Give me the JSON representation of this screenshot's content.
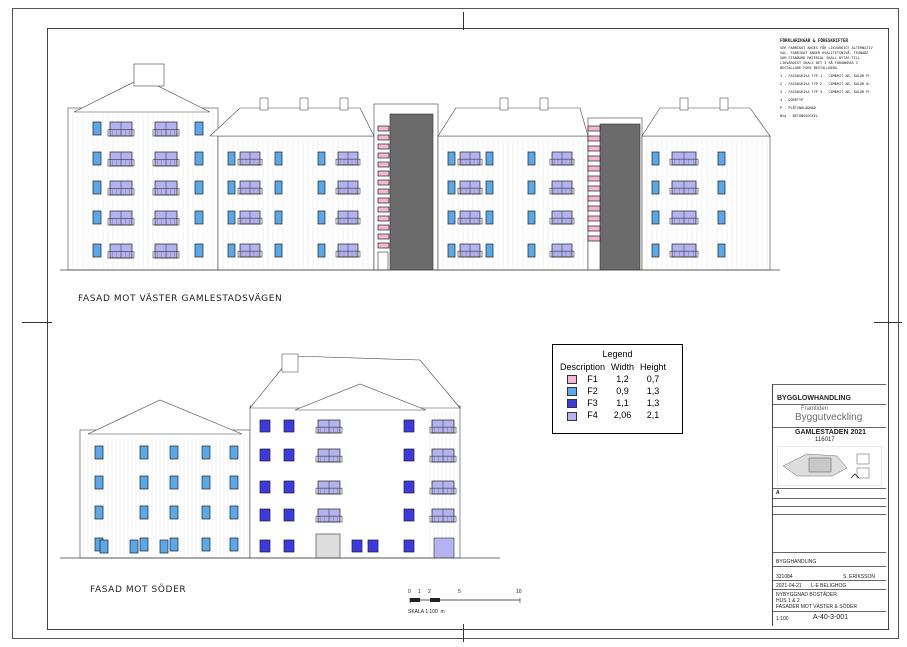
{
  "facade_titles": {
    "west": "FASAD MOT VÄSTER GAMLESTADSVÄGEN",
    "south": "FASAD MOT SÖDER"
  },
  "notes": {
    "heading": "FÖRKLARINGAR & FÖRESKRIFTER",
    "intro": "SER FABRIKAT ANGES FÅR LIKVÄRDIGT ALTERNATIV VAL. FABRIKAT ANGER KVALITETSNIVÅ. TEGNADE SOM STANDARD MATERIAL SKALL BYTAS TILL LIKVÄRDIGT SKALL DET I SÅ FÖRANKRAS I BESTÄLLARE FÖRE BESTÄLLNING.",
    "items": [
      "1 - FASADSKIVA TYP 1 - CEMBRIT AB, KULÖR M.",
      "2 - FASADSKIVA TYP 2 - CEMBRIT AB, KULÖR N.",
      "3 - FASADSKIVA TYP 3 - CEMBRIT AB, KULÖR M.",
      "4 - DÖRRTYP",
      "P - PLÅTINKLÄDNAD",
      "Btg - BETONGSOCKEL"
    ]
  },
  "legend": {
    "title": "Legend",
    "headers": [
      "Description",
      "Width",
      "Height"
    ],
    "rows": [
      {
        "desc": "F1",
        "width": "1,2",
        "height": "0,7",
        "color": "#f4b8d4"
      },
      {
        "desc": "F2",
        "width": "0,9",
        "height": "1,3",
        "color": "#5aa8ec"
      },
      {
        "desc": "F3",
        "width": "1,1",
        "height": "1,3",
        "color": "#3a3ae0"
      },
      {
        "desc": "F4",
        "width": "2,06",
        "height": "2,1",
        "color": "#b5b2f2"
      }
    ]
  },
  "scale": {
    "label": "SKALA 1:100",
    "ticks": [
      "0",
      "1",
      "2",
      "5",
      "10"
    ],
    "unit": "m"
  },
  "title_block": {
    "firm": "BYGGLOWHANDLING",
    "logo_top": "Framtiden",
    "logo_main": "Byggutveckling",
    "project": "GAMLESTADEN 2021",
    "project_no": "116017",
    "rev_label": "A",
    "field_company": "BYGGHANDLING",
    "field_no": "321084",
    "designer": "S. ERIKSSON",
    "date": "2021-04-21",
    "checked": "L-E BELIGHOG",
    "desc1": "NYBYGGNAD BOSTÄDER",
    "desc2": "HUS 1 & 2",
    "desc3": "FASADER MOT VÄSTER & SÖDER",
    "sheet_scale": "1:100",
    "drawing_no": "A-40-3-001"
  },
  "btg_label": "Btg"
}
